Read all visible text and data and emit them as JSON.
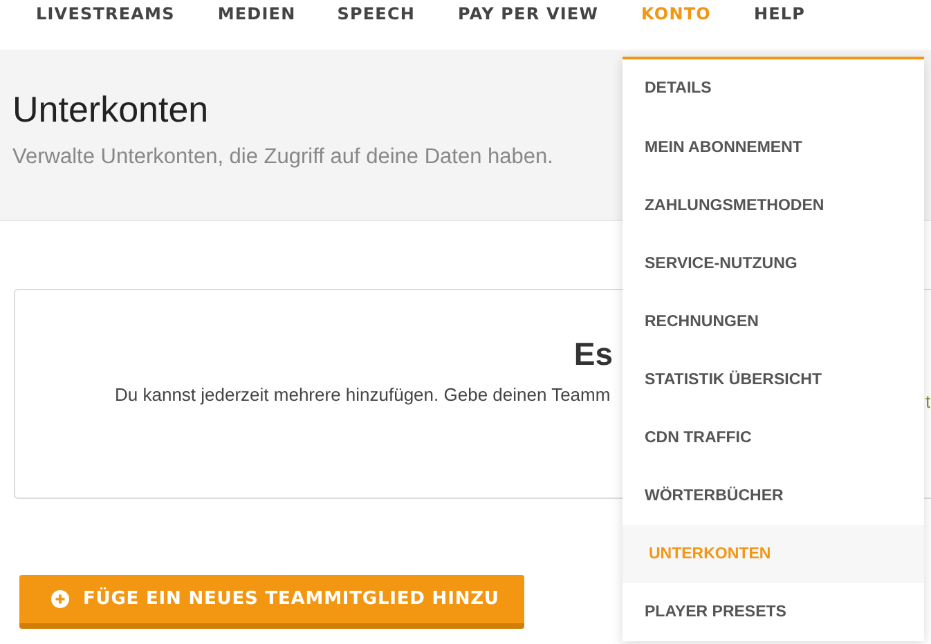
{
  "nav": [
    {
      "label": "LIVESTREAMS",
      "selected": false
    },
    {
      "label": "MEDIEN",
      "selected": false
    },
    {
      "label": "SPEECH",
      "selected": false
    },
    {
      "label": "PAY PER VIEW",
      "selected": false
    },
    {
      "label": "KONTO",
      "selected": true
    },
    {
      "label": "HELP",
      "selected": false
    }
  ],
  "header": {
    "title": "Unterkonten",
    "subtitle": "Verwalte Unterkonten, die Zugriff auf deine Daten haben."
  },
  "empty_state": {
    "heading": "Es",
    "text": "Du kannst jederzeit mehrere hinzufügen. Gebe deinen Teamm",
    "text_tail": "t"
  },
  "add_button": {
    "label": "FÜGE EIN NEUES TEAMMITGLIED HINZU"
  },
  "menu": [
    {
      "label": "DETAILS",
      "selected": false
    },
    {
      "label": "MEIN ABONNEMENT",
      "selected": false
    },
    {
      "label": "ZAHLUNGSMETHODEN",
      "selected": false
    },
    {
      "label": "SERVICE-NUTZUNG",
      "selected": false
    },
    {
      "label": "RECHNUNGEN",
      "selected": false
    },
    {
      "label": "STATISTIK ÜBERSICHT",
      "selected": false
    },
    {
      "label": "CDN TRAFFIC",
      "selected": false
    },
    {
      "label": "WÖRTERBÜCHER",
      "selected": false
    },
    {
      "label": "UNTERKONTEN",
      "selected": true
    },
    {
      "label": "PLAYER PRESETS",
      "selected": false
    }
  ]
}
